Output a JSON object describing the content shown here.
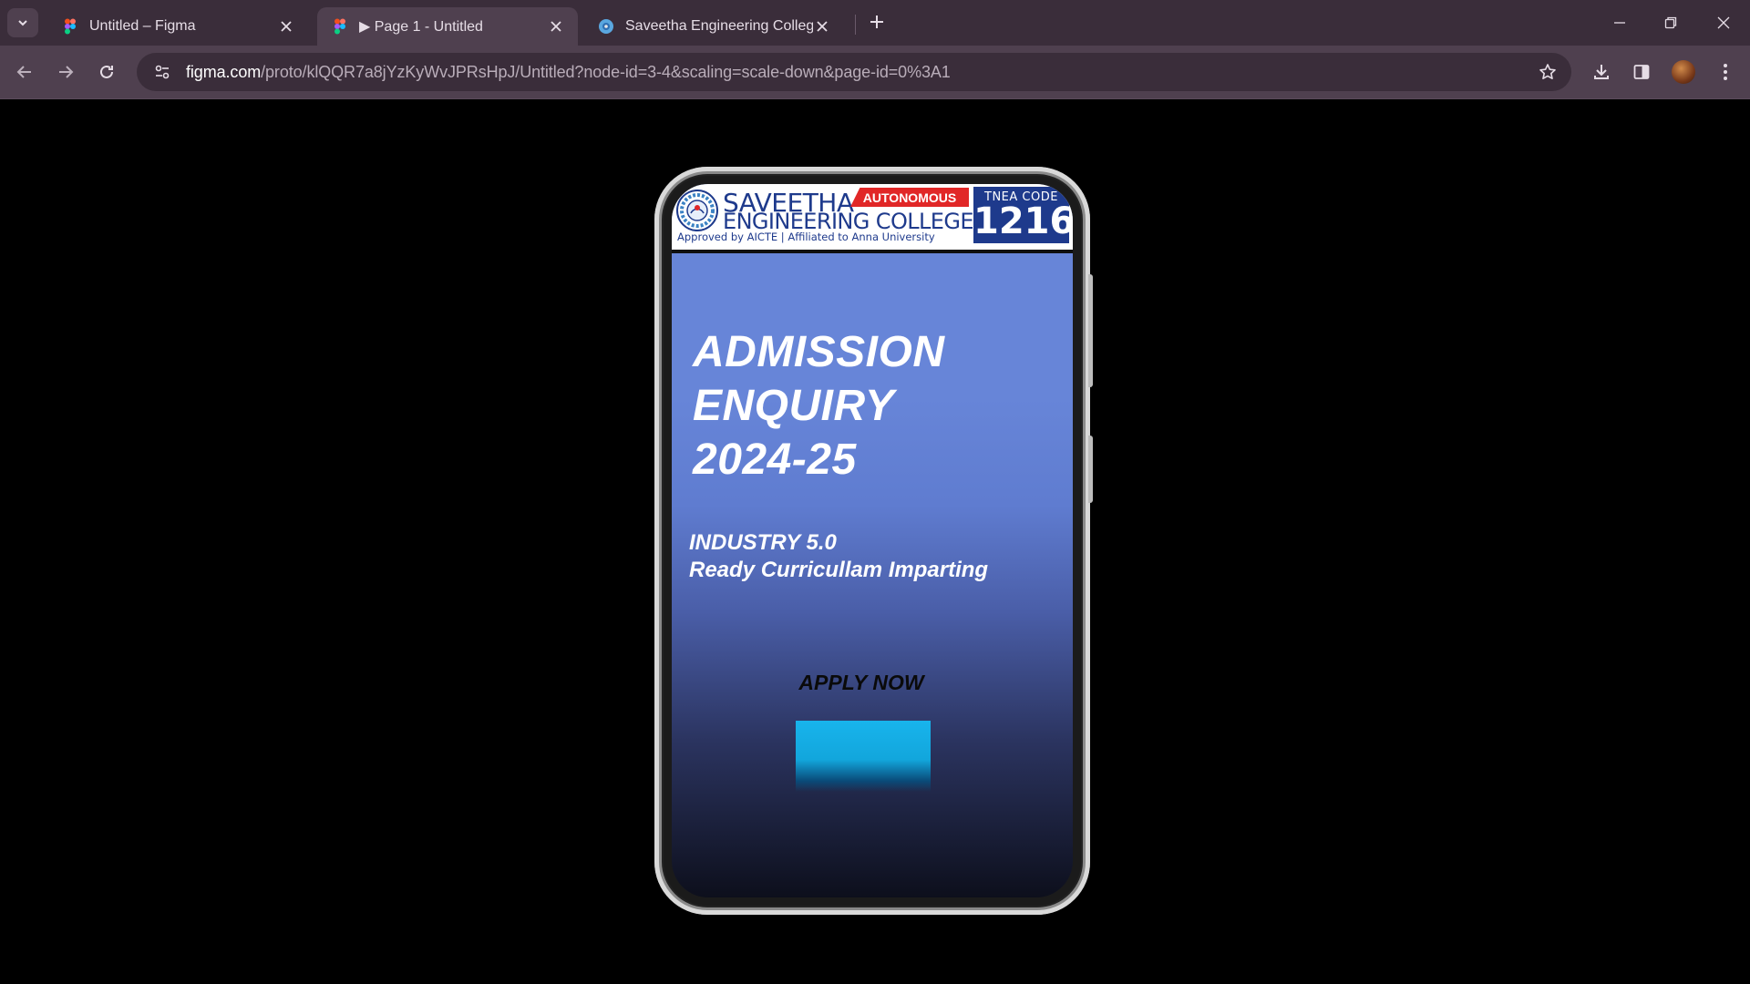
{
  "browser": {
    "tabs": [
      {
        "title": "Untitled – Figma",
        "active": false
      },
      {
        "title": "▶ Page 1 - Untitled",
        "active": true
      },
      {
        "title": "Saveetha Engineering College",
        "active": false
      }
    ],
    "url_host": "figma.com",
    "url_path": "/proto/klQQR7a8jYzKyWvJPRsHpJ/Untitled?node-id=3-4&scaling=scale-down&page-id=0%3A1"
  },
  "banner": {
    "name_line1": "SAVEETHA",
    "autonomous": "AUTONOMOUS",
    "name_line2": "ENGINEERING COLLEGE",
    "approval": "Approved by AICTE  |  Affiliated to Anna University",
    "tnea_label": "TNEA CODE",
    "tnea_code": "1216"
  },
  "hero": {
    "line1": "ADMISSION",
    "line2": "ENQUIRY",
    "line3": "2024-25",
    "tag1": "INDUSTRY 5.0",
    "tag2": "Ready Curricullam Imparting",
    "apply_label": "APPLY NOW"
  },
  "colors": {
    "chrome_dark": "#3a2d3a",
    "chrome_toolbar": "#4f404f",
    "screen_blue": "#6785d8",
    "banner_blue": "#1e3a8c",
    "autonomous_red": "#e12727",
    "apply_cyan": "#18b4ec"
  }
}
